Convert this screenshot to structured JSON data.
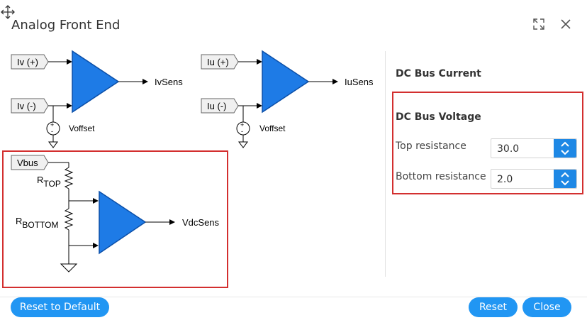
{
  "dialog": {
    "title": "Analog Front End"
  },
  "header": {
    "expand_icon": "expand-icon",
    "close_icon": "close-icon",
    "move_icon": "move-cursor-icon"
  },
  "diagram": {
    "iv_pos": "Iv (+)",
    "iv_neg": "Iv (-)",
    "iv_out": "IvSens",
    "iu_pos": "Iu (+)",
    "iu_neg": "Iu (-)",
    "iu_out": "IuSens",
    "voffset_1": "Voffset",
    "voffset_2": "Voffset",
    "vbus": "Vbus",
    "rtop_r": "R",
    "rtop_sub": "TOP",
    "rbottom_r": "R",
    "rbottom_sub": "BOTTOM",
    "vdc_out": "VdcSens"
  },
  "settings": {
    "dc_bus_current": "DC Bus Current",
    "dc_bus_voltage": "DC Bus Voltage",
    "top_resistance_label": "Top resistance",
    "top_resistance_value": "30.0",
    "bottom_resistance_label": "Bottom resistance",
    "bottom_resistance_value": "2.0"
  },
  "footer": {
    "reset_default": "Reset to Default",
    "reset": "Reset",
    "close": "Close"
  },
  "colors": {
    "accent": "#2196f3",
    "amp_fill": "#1e7be6",
    "highlight": "#d32f2f"
  }
}
